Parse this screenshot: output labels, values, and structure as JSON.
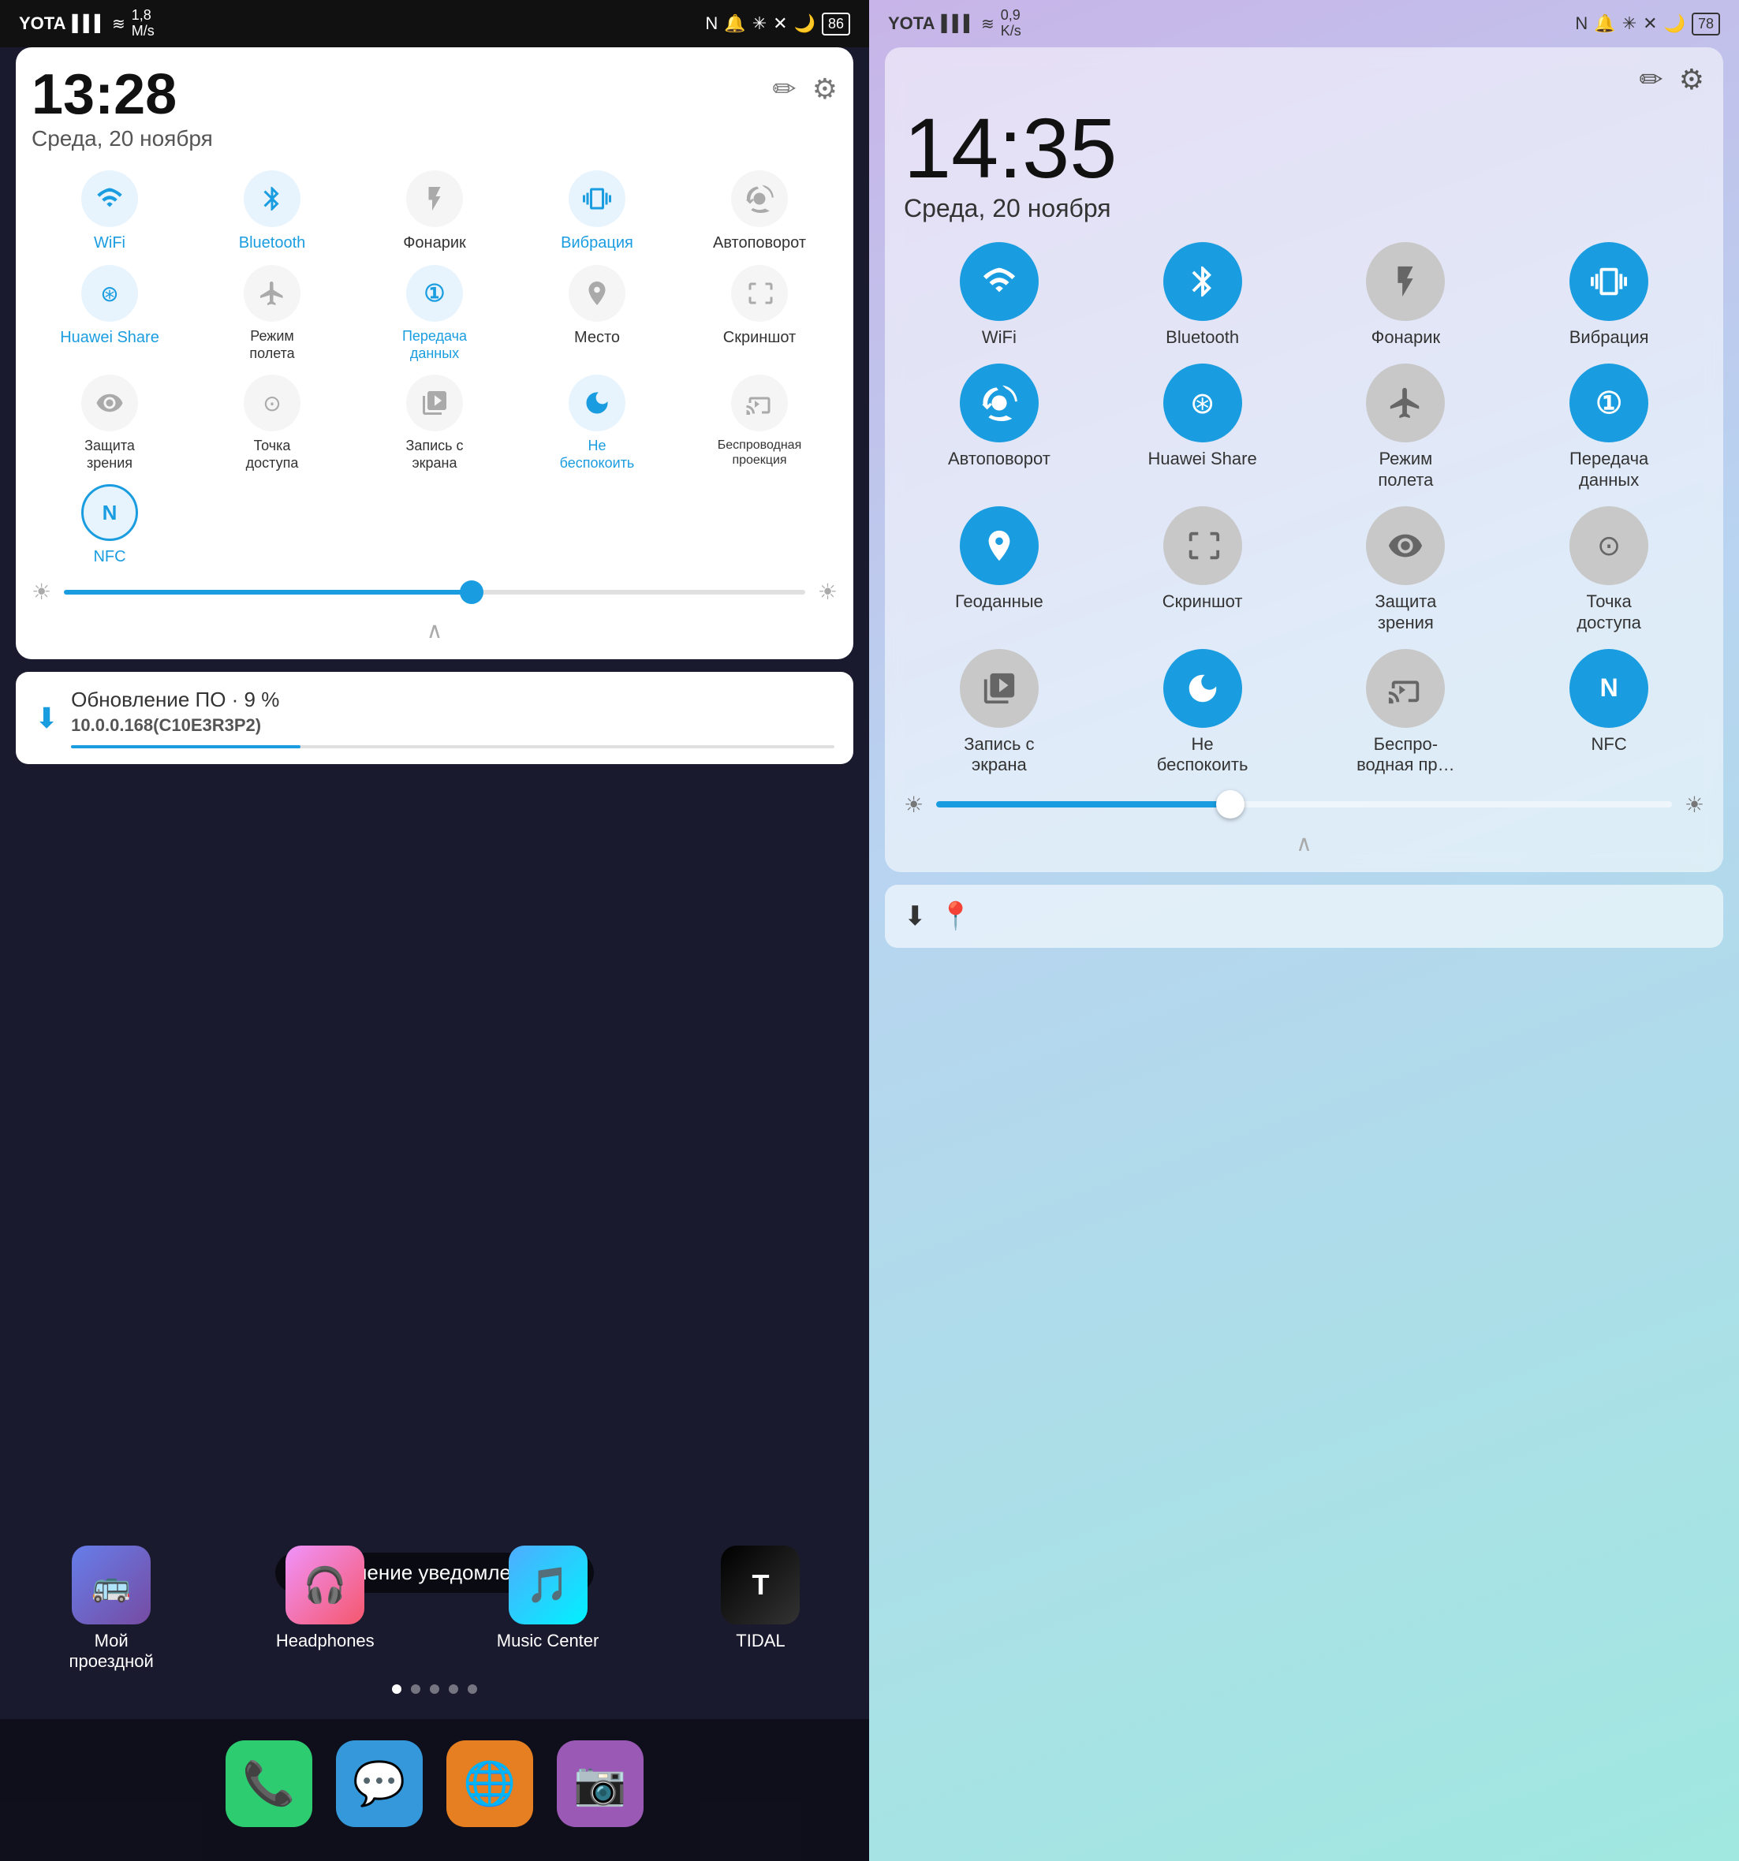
{
  "left": {
    "status_bar": {
      "carrier": "YOTA",
      "signal": "▌▌▌",
      "wifi": "WiFi",
      "speed": "1,8\nM/s",
      "battery": "86",
      "icons": "🔔🔵✕🌙📱"
    },
    "panel": {
      "time": "13:28",
      "date": "Среда, 20 ноября",
      "edit_icon": "✏",
      "settings_icon": "⚙"
    },
    "toggles": [
      {
        "label": "WiFi",
        "label_text": "WiFi",
        "active": true,
        "icon": "📶"
      },
      {
        "label": "Bluetooth",
        "label_text": "Bluetooth",
        "active": true,
        "icon": "🔵"
      },
      {
        "label": "Фонарик",
        "label_text": "Фонарик",
        "active": false,
        "icon": "🔦"
      },
      {
        "label": "Вибрация",
        "label_text": "Вибрация",
        "active": true,
        "icon": "📳"
      },
      {
        "label": "Автоповорот",
        "label_text": "Автоповорот",
        "active": false,
        "icon": "🔄"
      },
      {
        "label": "Huawei Share",
        "label_text": "Huawei Share",
        "active": true,
        "icon": "📡"
      },
      {
        "label": "Режим полета",
        "label_text": "Режим\nполета",
        "active": false,
        "icon": "✈"
      },
      {
        "label": "Передача данных",
        "label_text": "Передача\nданных",
        "active": true,
        "icon": "🔢"
      },
      {
        "label": "Место",
        "label_text": "Место",
        "active": false,
        "icon": "📍"
      },
      {
        "label": "Скриншот",
        "label_text": "Скриншот",
        "active": false,
        "icon": "📷"
      },
      {
        "label": "Защита зрения",
        "label_text": "Защита\nзрения",
        "active": false,
        "icon": "👁"
      },
      {
        "label": "Точка доступа",
        "label_text": "Точка\nдоступа",
        "active": false,
        "icon": "📡"
      },
      {
        "label": "Запись с экрана",
        "label_text": "Запись с\nэкрана",
        "active": false,
        "icon": "📹"
      },
      {
        "label": "Не беспокоить",
        "label_text": "Не\nбеспокоить",
        "active": true,
        "icon": "🌙"
      },
      {
        "label": "Беспроводная проекция",
        "label_text": "Беспроводная\nпроекция",
        "active": false,
        "icon": "📺"
      },
      {
        "label": "NFC",
        "label_text": "NFC",
        "active": true,
        "icon": "N"
      }
    ],
    "notification": {
      "icon": "⬇",
      "title": "Обновление ПО · 9 %",
      "subtitle": "10.0.0.168(C10E3R3P2)",
      "progress": 9
    },
    "manage_notifications": "Управление уведомлениями",
    "apps": [
      {
        "label": "Мой\nпроездной",
        "color": "app-mytravel",
        "icon": "🚌"
      },
      {
        "label": "Headphones",
        "color": "app-headphones",
        "icon": "🎧"
      },
      {
        "label": "Music Center",
        "color": "app-music",
        "icon": "🎵"
      },
      {
        "label": "TIDAL",
        "color": "app-tidal",
        "icon": "T"
      }
    ],
    "bottom_apps": [
      {
        "icon": "📞",
        "color": "#2ecc71"
      },
      {
        "icon": "💬",
        "color": "#3498db"
      },
      {
        "icon": "🌐",
        "color": "#e67e22"
      },
      {
        "icon": "📷",
        "color": "#9b59b6"
      }
    ]
  },
  "right": {
    "status_bar": {
      "carrier": "YOTA",
      "speed": "0,9\nK/s",
      "battery": "78",
      "icons": "🔔🔵✕🌙📱"
    },
    "panel": {
      "time": "14:35",
      "date": "Среда, 20 ноября",
      "edit_icon": "✏",
      "settings_icon": "⚙"
    },
    "toggles": [
      {
        "label": "WiFi",
        "label_text": "WiFi",
        "active": true,
        "icon": "📶"
      },
      {
        "label": "Bluetooth",
        "label_text": "Bluetooth",
        "active": true,
        "icon": "🔵"
      },
      {
        "label": "Фонарик",
        "label_text": "Фонарик",
        "active": false,
        "icon": "🔦"
      },
      {
        "label": "Вибрация",
        "label_text": "Вибрация",
        "active": true,
        "icon": "📳"
      },
      {
        "label": "Автоповорот",
        "label_text": "Автоповорот",
        "active": true,
        "icon": "🔄"
      },
      {
        "label": "Huawei Share",
        "label_text": "Huawei Share",
        "active": true,
        "icon": "📡"
      },
      {
        "label": "Режим полета",
        "label_text": "Режим\nполета",
        "active": false,
        "icon": "✈"
      },
      {
        "label": "Передача данных",
        "label_text": "Передача\nданных",
        "active": true,
        "icon": "🔢"
      },
      {
        "label": "Геоданные",
        "label_text": "Геоданные",
        "active": true,
        "icon": "📍"
      },
      {
        "label": "Скриншот",
        "label_text": "Скриншот",
        "active": false,
        "icon": "✂"
      },
      {
        "label": "Защита зрения",
        "label_text": "Защита\nзрения",
        "active": false,
        "icon": "👁"
      },
      {
        "label": "Точка доступа",
        "label_text": "Точка\nдоступа",
        "active": false,
        "icon": "📡"
      },
      {
        "label": "Запись с экрана",
        "label_text": "Запись с\nэкрана",
        "active": false,
        "icon": "📹"
      },
      {
        "label": "Не беспокоить",
        "label_text": "Не\nбеспокоить",
        "active": true,
        "icon": "🌙"
      },
      {
        "label": "Беспроводная пр...",
        "label_text": "Беспро-\nводная пр…",
        "active": false,
        "icon": "📺"
      },
      {
        "label": "NFC",
        "label_text": "NFC",
        "active": true,
        "icon": "N"
      }
    ],
    "bottom_bar": {
      "icons": [
        "⬇",
        "📍"
      ]
    }
  }
}
